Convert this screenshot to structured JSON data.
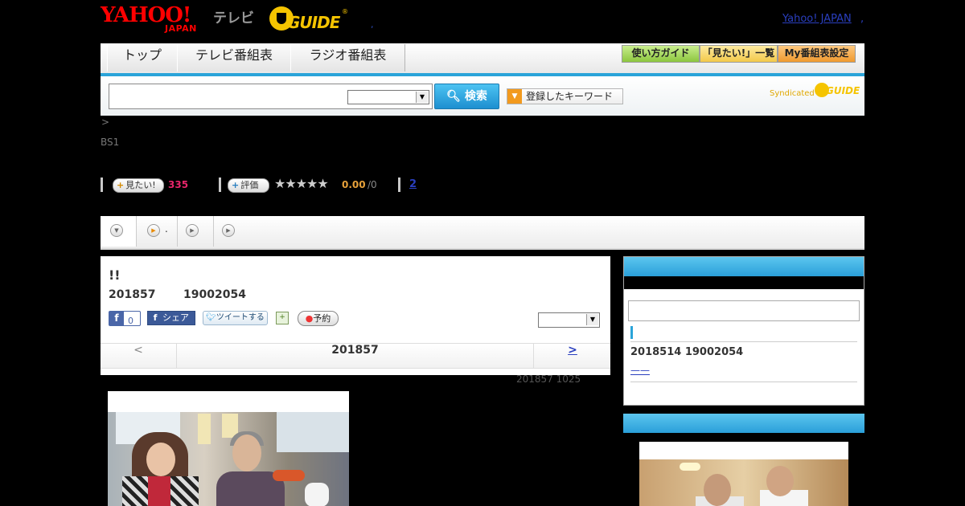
{
  "header": {
    "yahoo_logo_main": "YAHOO!",
    "yahoo_logo_sub": "JAPAN",
    "tv_label": "テレビ",
    "gguide_logo": "GUIDE",
    "gguide_reg": "®",
    "dot": ",",
    "yahoo_japan_link": "Yahoo! JAPAN",
    "comma": ","
  },
  "nav": {
    "tabs": [
      {
        "label": "トップ"
      },
      {
        "label": "テレビ番組表"
      },
      {
        "label": "ラジオ番組表"
      }
    ],
    "buttons": [
      {
        "label": "使い方ガイド",
        "color": "#9bd14c"
      },
      {
        "label": "「見たい!」一覧",
        "color": "#f6d25a"
      },
      {
        "label": "My番組表設定",
        "color": "#f2a43a"
      }
    ]
  },
  "search": {
    "input_value": "",
    "genre_value": "",
    "button_label": "検索",
    "keyword_button_label": "登録したキーワード",
    "syndicated_label": "Syndicated",
    "syndicated_logo": "GUIDE"
  },
  "breadcrumb": ">",
  "channel": "BS1",
  "rating_row": {
    "want_label": "見たい!",
    "want_count": "335",
    "rate_label": "評価",
    "stars": "★★★★★",
    "score": "0.00",
    "score_denominator": "/0",
    "review_link": "2"
  },
  "tabstrip": {
    "tab2_label": "."
  },
  "program": {
    "title": "!!",
    "date": "201857",
    "time": "19002054",
    "fb_like_count": "0",
    "fb_share_label": "シェア",
    "tweet_label": "ツイートする",
    "reserve_label": "予約",
    "nav_prev": "<",
    "nav_date": "201857",
    "nav_next": ">",
    "updated": "201857  1025"
  },
  "sidebar": {
    "related_date": "2018514  19002054",
    "related_link": "——"
  },
  "colors": {
    "accent_blue": "#2aa4d9",
    "want_count": "#e8256a",
    "score": "#e7a13a",
    "link": "#2a3fbf"
  }
}
